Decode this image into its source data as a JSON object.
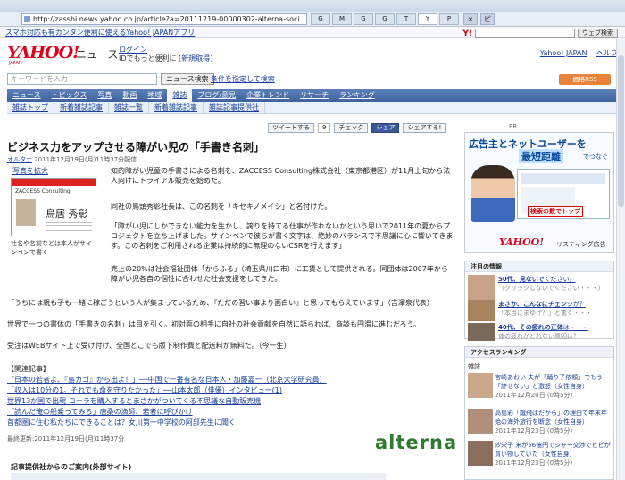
{
  "browser": {
    "url": "http://zasshi.news.yahoo.co.jp/article?a=20111219-00000302-alterna-soci",
    "tabs": [
      "G",
      "M",
      "G",
      "G",
      "T",
      "Y",
      "P"
    ],
    "controls": [
      "×",
      "ピ"
    ],
    "bookmark_text": "スマホ対応も有カンタン便利に使えるYahoo! JAPANアプリ"
  },
  "yahoo_toolbar": {
    "brand": "Y!",
    "search_button": "ウェブ検索"
  },
  "header": {
    "logo": "YAHOO!",
    "logo_sub": "JAPAN",
    "site_name": "ニュース",
    "login": "ログイン",
    "login_sub": "IDでもっと便利に [",
    "register": "新規取得",
    "login_sub_end": "]",
    "top_links": [
      "Yahoo! JAPAN",
      "ヘルプ"
    ]
  },
  "search": {
    "placeholder": "キーワードを入力",
    "button": "ニュース検索",
    "condition": "条件を指定して検索",
    "rss": "価格RSS"
  },
  "nav": {
    "primary": [
      "ニュース",
      "トピックス",
      "写真",
      "動画",
      "地域",
      "雑誌",
      "ブログ/意見",
      "企業トレンド",
      "リサーチ",
      "ランキング"
    ],
    "active_index": 5,
    "secondary": [
      "雑誌トップ",
      "新着雑誌記事",
      "雑誌一覧",
      "新着雑誌記事",
      "雑誌記事提供社"
    ]
  },
  "social": {
    "tweet": "ツイートする",
    "tweet_count": "9",
    "check": "チェック",
    "facebook": "シェア",
    "share": "シェアする!",
    "pr": "PR"
  },
  "article": {
    "title": "ビジネス力をアップさせる障がい児の「手書き名刺」",
    "source": "オルタナ",
    "date": " 2011年12月19日(月)11時37分配信",
    "thumb_link": "写真を拡大",
    "card_logo": "ZACCESS Consulting",
    "card_name": "鳥居 秀彰",
    "caption": "社名や名前などは本人がサインペンで書く",
    "paragraphs": [
      "知的障がい児童の手書きによる名刺を、ZACCESS Consulting株式会社（東京都港区）が11月上旬から法人向けにトライアル販売を始めた。",
      "同社の鳥頭秀彰社長は、この名刺を「キセキノメイシ」と名付けた。",
      "「障がい児にしかできない能力を生かし、誇りを持てる仕事が作れないかという思いで2011年の夏からプロジェクトを立ち上げました。サインペンで彼らが書く文字は、絶妙のバランスで不思議に心に響いてきます。この名刺をご利用される企業は持続的に無理のないCSRを行えます」",
      "売上の20%は社会福祉団体「からふる」（埼玉県川口市）に工賃として提供される。同団体は2007年から障がい児各自の個性に合わせた社会支援をしてきた。",
      "「うちには親も子も一緒に稼ごうという人が集まっているため、『ただの習い事より面白い』と思ってもらえています」（吉澤泉代表）",
      "世界で一つの書体の「手書きの名刺」は目を引く。初対面の相手に自社の社会貢献を自然に語られば、商談も円滑に進むだろう。",
      "受注はWEBサイト上で受け付け、全国どこでも版下制作費と配送料が無料だ。（今一生）"
    ],
    "related_heading": "【関連記事】",
    "related": [
      "「日本の若者よ、『島カゴ』から出よ！」──中国で一番有名な日本人・加藤嘉一（北京大学研究員）",
      "「収入は10分の1。それでも命を守りたかった」──山本太郎（俳優）インタビュー(1)",
      "世界13か国で出現 コーラを購入するとまさかがついてくる不思議な自動販売機",
      "「読んだ俺の船乗ってみろ」唐桑の漁師、若者に呼びかけ",
      "首都圏に住む私たちにできることは？女川第一中学校の阿部先生に聞く"
    ],
    "last_modified": "最終更新:2011年12月19日(月)11時37分",
    "brand": "alterna",
    "provider_heading": "記事提供社からのご案内(外部サイト)"
  },
  "ad": {
    "headline": "広告主とネットユーザーを",
    "headline2": "最短距離",
    "headline3": "でつなぐ",
    "callout": "検索の数でトップ",
    "logo": "YAHOO!",
    "sub": "リスティング広告"
  },
  "attention": {
    "heading": "注目の情報",
    "items": [
      {
        "title": "50代、見ないで",
        "sub": "ください。",
        "desc": "（クリックしないでください・・・）"
      },
      {
        "title": "まさか、こんなにチェン",
        "sub": "ジが？",
        "desc": "「本当にまゆげ？」と驚く・・・"
      },
      {
        "title": "40代、その疲れの正体",
        "sub": "は・・・",
        "desc": "体の疲れがとれない原因は？"
      }
    ]
  },
  "ranking": {
    "heading": "アクセスランキング",
    "sub": "雑誌",
    "items": [
      {
        "text": "宮崎あおい 夫が「踊り子依頼」でもう「許せない」と激怒",
        "source": "（女性自身）",
        "date": "2011年12月20日 (0時5分)"
      },
      {
        "text": "高島彩「蹴飛ばだから」の理由で年末年始の海外旅行を断念",
        "source": "（女性自身）",
        "date": "2011年12月23日 (0時5分)"
      },
      {
        "text": "紗栄子 米が56億円でジャー交渉でヒビが 買い物していた",
        "source": "（女性自身）",
        "date": "2011年12月23日 (0時5分)"
      }
    ]
  },
  "colors": {
    "yahoo_red": "#e0001b",
    "nav_blue": "#3f639e",
    "link_blue": "#1a3e9a",
    "alterna_green": "#2f7a2f"
  }
}
